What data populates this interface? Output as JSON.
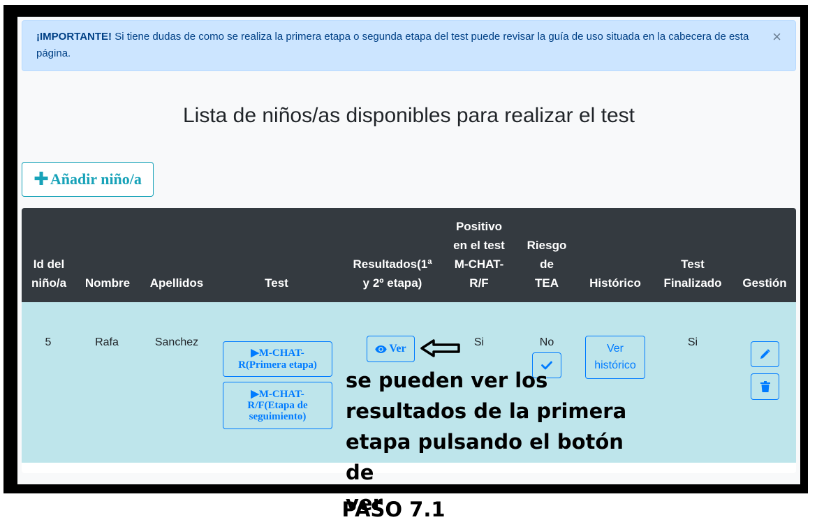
{
  "alert": {
    "strong": "¡IMPORTANTE!",
    "text": " Si tiene dudas de como se realiza la primera etapa o segunda etapa del test puede revisar la guía de uso situada en la cabecera de esta página.",
    "close": "×"
  },
  "page_title": "Lista de niños/as disponibles para realizar el test",
  "add_button": {
    "icon": "plus-icon",
    "label": "Añadir niño/a"
  },
  "table": {
    "headers": {
      "id": [
        "Id del",
        "niño/a"
      ],
      "nombre": "Nombre",
      "apellidos": "Apellidos",
      "test": "Test",
      "resultados": [
        "Resultados(1ª",
        "y 2º etapa)"
      ],
      "positivo": [
        "Positivo",
        "en el test",
        "M-CHAT-",
        "R/F"
      ],
      "riesgo": [
        "Riesgo",
        "de",
        "TEA"
      ],
      "historico": "Histórico",
      "finalizado": [
        "Test",
        "Finalizado"
      ],
      "gestion": "Gestión"
    },
    "row": {
      "id": "5",
      "nombre": "Rafa",
      "apellidos": "Sanchez",
      "test_btn1": [
        "M-CHAT-",
        "R(Primera etapa)"
      ],
      "test_btn2": [
        "M-CHAT-",
        "R/F(Etapa de",
        "seguimiento)"
      ],
      "ver_label": "Ver",
      "positivo": "Si",
      "riesgo": "No",
      "historico_btn": [
        "Ver",
        "histórico"
      ],
      "finalizado": "Si"
    }
  },
  "annotation": {
    "lines": [
      "se pueden ver los",
      "resultados de la primera",
      "etapa pulsando el botón de",
      "ver"
    ],
    "step": "PASO 7.1"
  },
  "colors": {
    "info_bg": "#cce5ff",
    "header_bg": "#343a40",
    "row_bg": "#bee5eb",
    "primary": "#007bff",
    "teal": "#17a2b8"
  }
}
